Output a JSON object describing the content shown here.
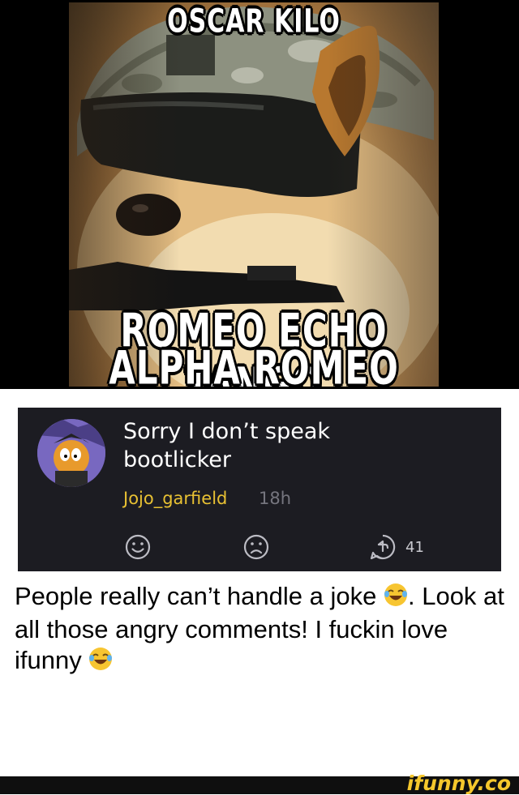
{
  "meme": {
    "top_text": "OSCAR KILO",
    "bottom_line1": "ROMEO ECHO TANGO",
    "bottom_line2": "ALPHA ROMEO DELTA"
  },
  "comment": {
    "text_line1": "Sorry I don’t speak",
    "text_line2": "bootlicker",
    "username": "Jojo_garfield",
    "time": "18h",
    "reply_count": "41"
  },
  "caption": {
    "text1": "People really can’t handle a joke",
    "text2": ". Look at all those angry comments! I fuckin love ifunny"
  },
  "footer": {
    "logo": "ifunny.co"
  },
  "colors": {
    "card_bg": "#1c1c22",
    "username": "#e8c133",
    "logo": "#f5c72c"
  }
}
